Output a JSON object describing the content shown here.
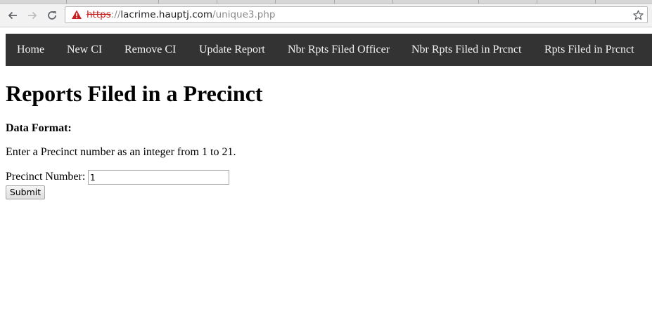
{
  "browser": {
    "url": {
      "scheme": "https",
      "separator": "://",
      "host": "lacrime.hauptj.com",
      "path": "/unique3.php"
    },
    "icons": {
      "back": "back-arrow-icon",
      "forward": "forward-arrow-icon",
      "reload": "reload-icon",
      "security": "not-secure-warning-icon",
      "bookmark": "bookmark-star-icon"
    },
    "colors": {
      "warning": "#c5221f"
    }
  },
  "nav": {
    "items": [
      {
        "label": "Home"
      },
      {
        "label": "New CI"
      },
      {
        "label": "Remove CI"
      },
      {
        "label": "Update Report"
      },
      {
        "label": "Nbr Rpts Filed Officer"
      },
      {
        "label": "Nbr Rpts Filed in Prcnct"
      },
      {
        "label": "Rpts Filed in Prcnct"
      }
    ],
    "background": "#333333"
  },
  "page": {
    "title": "Reports Filed in a Precinct",
    "format_label": "Data Format:",
    "instructions": "Enter a Precinct number as an integer from 1 to 21."
  },
  "form": {
    "precinct_label": "Precinct Number:",
    "precinct_value": "1",
    "submit_label": "Submit"
  }
}
